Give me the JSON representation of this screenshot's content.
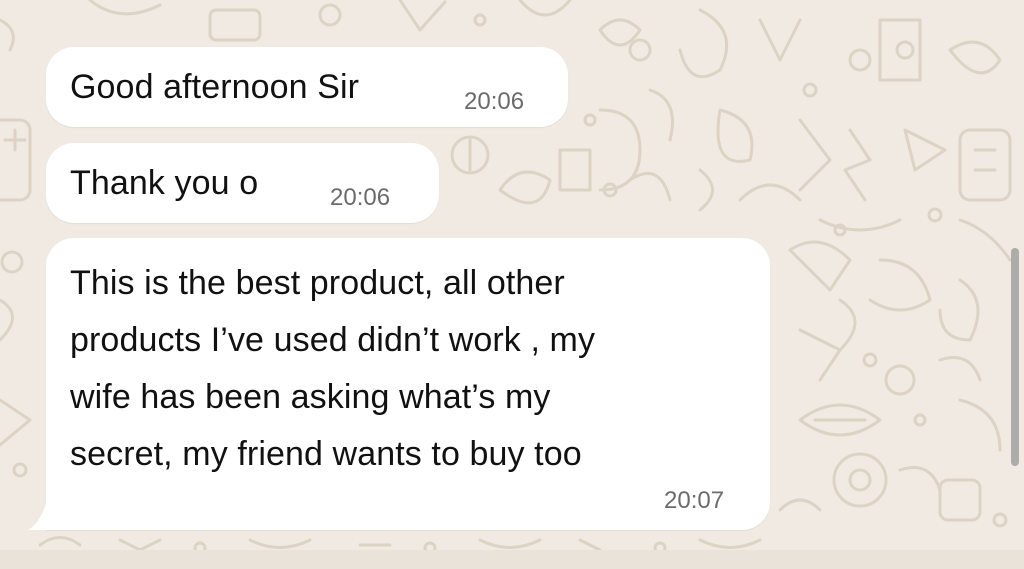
{
  "colors": {
    "wallpaper": "#f0eae2",
    "doodle": "#dcd2c3",
    "bubble": "#ffffff",
    "text": "#111111",
    "time": "#6b6b6b"
  },
  "messages": [
    {
      "text": "Good afternoon Sir",
      "time": "20:06",
      "direction": "incoming"
    },
    {
      "text": "Thank you o",
      "time": "20:06",
      "direction": "incoming"
    },
    {
      "text": "This is the best product, all other\nproducts I’ve used didn’t work , my\nwife has been asking what’s my\nsecret, my friend wants to buy too",
      "time": "20:07",
      "direction": "incoming"
    }
  ],
  "icons": [
    "chat-wallpaper-doodle-icons",
    "bubble-tail-icon"
  ]
}
